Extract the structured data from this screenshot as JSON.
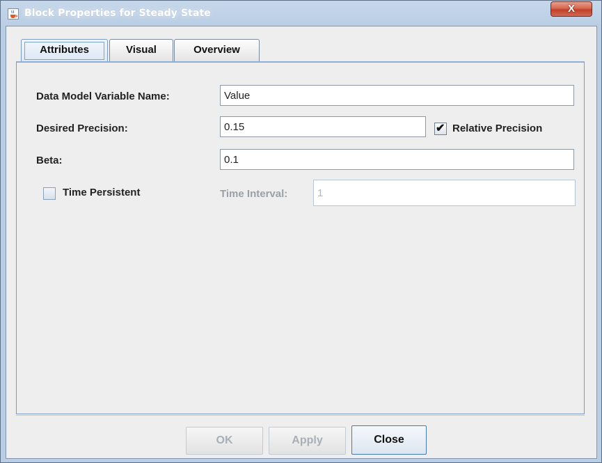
{
  "window": {
    "title": "Block Properties for Steady State",
    "close_glyph": "X",
    "title_icon": "java-cup-icon"
  },
  "tabs": [
    {
      "label": "Attributes",
      "selected": true
    },
    {
      "label": "Visual",
      "selected": false
    },
    {
      "label": "Overview",
      "selected": false
    }
  ],
  "form": {
    "variable_name_label": "Data Model Variable Name:",
    "variable_name_value": "Value",
    "precision_label": "Desired Precision:",
    "precision_value": "0.15",
    "relative_precision_label": "Relative Precision",
    "relative_precision_checked": true,
    "beta_label": "Beta:",
    "beta_value": "0.1",
    "time_persistent_label": "Time Persistent",
    "time_persistent_checked": false,
    "time_interval_label": "Time Interval:",
    "time_interval_value": "1"
  },
  "buttons": {
    "ok": "OK",
    "apply": "Apply",
    "close": "Close"
  },
  "colors": {
    "title_bar": "#b9cde4",
    "close_button": "#c2402a",
    "selected_tab_border": "#7a9cc4"
  }
}
